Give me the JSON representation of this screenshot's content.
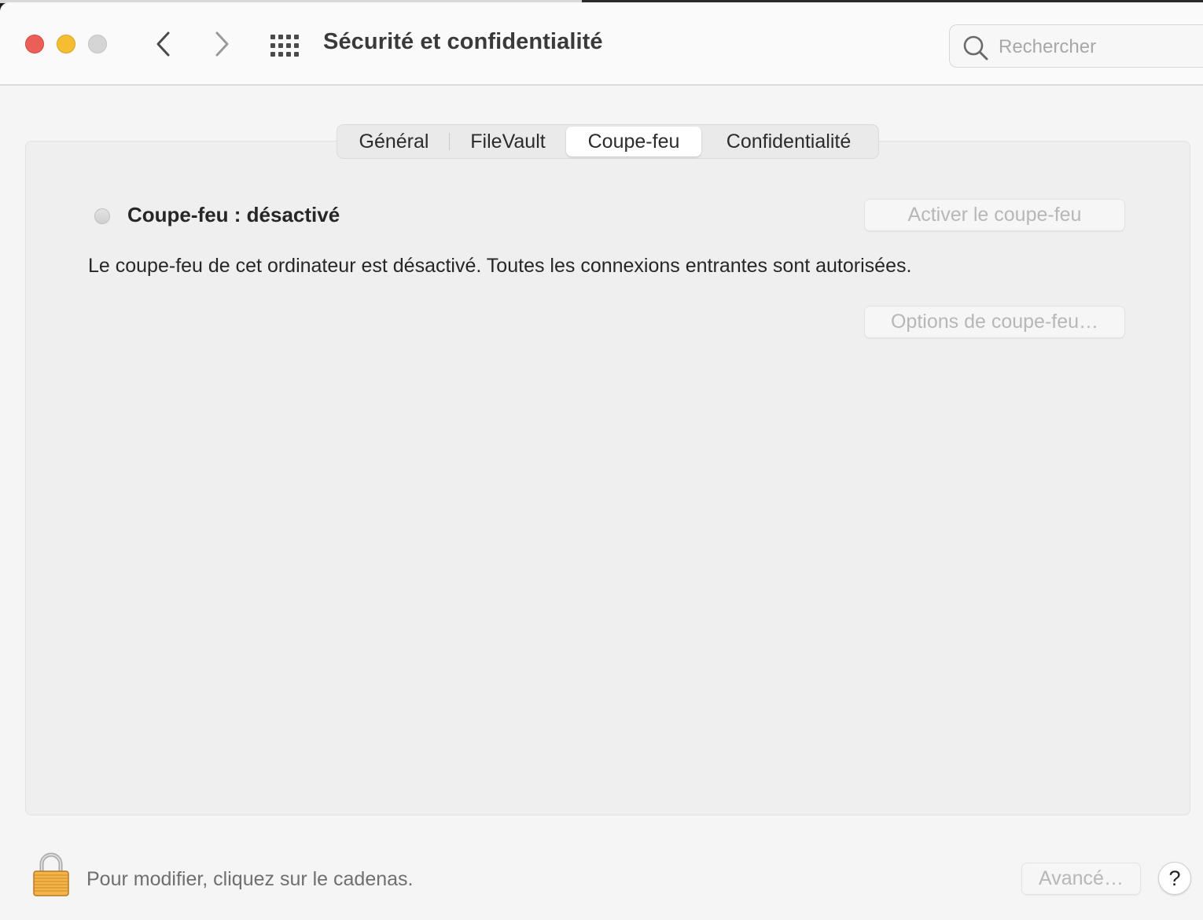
{
  "window": {
    "title": "Sécurité et confidentialité"
  },
  "search": {
    "placeholder": "Rechercher",
    "value": ""
  },
  "tabs": [
    {
      "label": "Général",
      "selected": false
    },
    {
      "label": "FileVault",
      "selected": false
    },
    {
      "label": "Coupe-feu",
      "selected": true
    },
    {
      "label": "Confidentialité",
      "selected": false
    }
  ],
  "firewall": {
    "status_label": "Coupe-feu : désactivé",
    "enable_button": "Activer le coupe-feu",
    "description": "Le coupe-feu de cet ordinateur est désactivé. Toutes les connexions entrantes sont autorisées.",
    "options_button": "Options de coupe-feu…"
  },
  "footer": {
    "lock_hint": "Pour modifier, cliquez sur le cadenas.",
    "advanced_button": "Avancé…",
    "help_label": "?"
  },
  "icons": {
    "back": "chevron-left-icon",
    "forward": "chevron-right-icon",
    "show_all": "grid-icon",
    "search": "search-icon",
    "lock": "lock-icon"
  },
  "colors": {
    "close": "#ec5f57",
    "minimize": "#f5bd2f",
    "maximize": "#d5d5d5"
  }
}
